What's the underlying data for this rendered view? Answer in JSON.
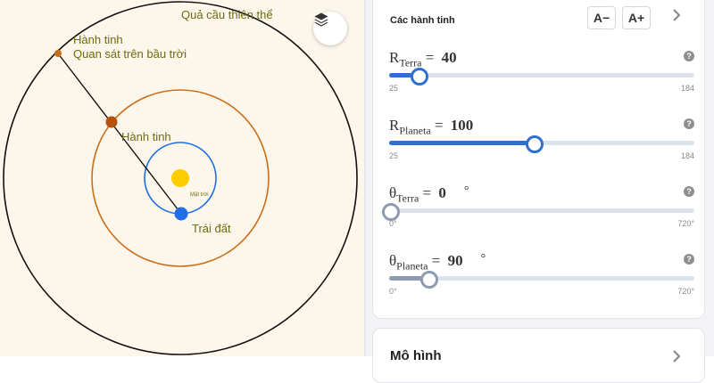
{
  "graphics": {
    "celestial_sphere_label": "Quả cầu thiên thể",
    "planet_observed_label_line1": "Hành tinh",
    "planet_observed_label_line2": "Quan sát trên bầu trời",
    "planet_label": "Hành tinh",
    "sun_label": "Mặt trời",
    "earth_label": "Trái đất",
    "colors": {
      "background": "#fdf6ea",
      "earth_orbit": "#1e6ee8",
      "planet_orbit": "#cc6e17",
      "sun": "#ffcc00",
      "earth": "#1e6ee8",
      "planet": "#b5520f",
      "label_text": "#6b6b10"
    }
  },
  "layers_button": {
    "icon": "layers-icon"
  },
  "panel": {
    "title": "Các hành tinh",
    "zoom_out_label": "A−",
    "zoom_in_label": "A+",
    "collapse_icon": "chevron-right-icon",
    "sliders": [
      {
        "symbol": "R",
        "sub": "Terra",
        "value": "40",
        "unit": "",
        "min": "25",
        "max": "184",
        "fill_color": "#2f6fd0",
        "thumb_color": "#2f6fd0"
      },
      {
        "symbol": "R",
        "sub": "Planeta",
        "value": "100",
        "unit": "",
        "min": "25",
        "max": "184",
        "fill_color": "#2f6fd0",
        "thumb_color": "#2f6fd0"
      },
      {
        "symbol": "θ",
        "sub": "Terra",
        "value": "0",
        "unit": "°",
        "min": "0°",
        "max": "720°",
        "fill_color": "#8f9bb0",
        "thumb_color": "#8f9bb0"
      },
      {
        "symbol": "θ",
        "sub": "Planeta",
        "value": "90",
        "unit": "°",
        "min": "0°",
        "max": "720°",
        "fill_color": "#8f9bb0",
        "thumb_color": "#8f9bb0"
      }
    ]
  },
  "model_card": {
    "title": "Mô hình",
    "icon": "chevron-right-icon"
  }
}
